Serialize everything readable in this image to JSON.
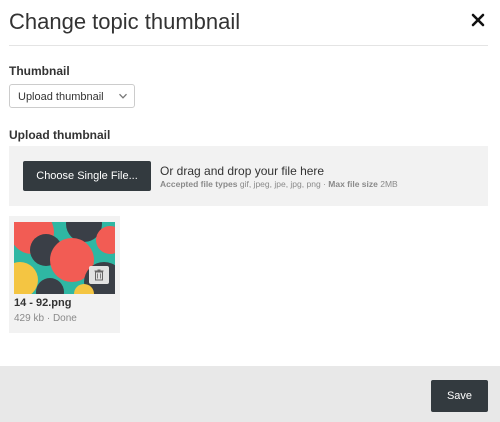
{
  "dialog": {
    "title": "Change topic thumbnail"
  },
  "thumbnail_field": {
    "label": "Thumbnail",
    "selected": "Upload thumbnail"
  },
  "upload_field": {
    "label": "Upload thumbnail",
    "choose_button": "Choose Single File...",
    "drop_text": "Or drag and drop your file here",
    "accepted_label": "Accepted file types",
    "accepted_types": "gif, jpeg, jpe, jpg, png",
    "separator": "·",
    "max_size_label": "Max file size",
    "max_size": "2MB"
  },
  "file": {
    "name": "14 - 92.png",
    "size": "429 kb",
    "separator": "·",
    "status": "Done"
  },
  "footer": {
    "save_label": "Save"
  },
  "colors": {
    "dark_button": "#333a3f",
    "panel_bg": "#f2f2f2",
    "footer_bg": "#e8e8e8"
  },
  "icons": {
    "close": "close-icon",
    "chevron": "chevron-down-icon",
    "delete": "trash-icon"
  }
}
